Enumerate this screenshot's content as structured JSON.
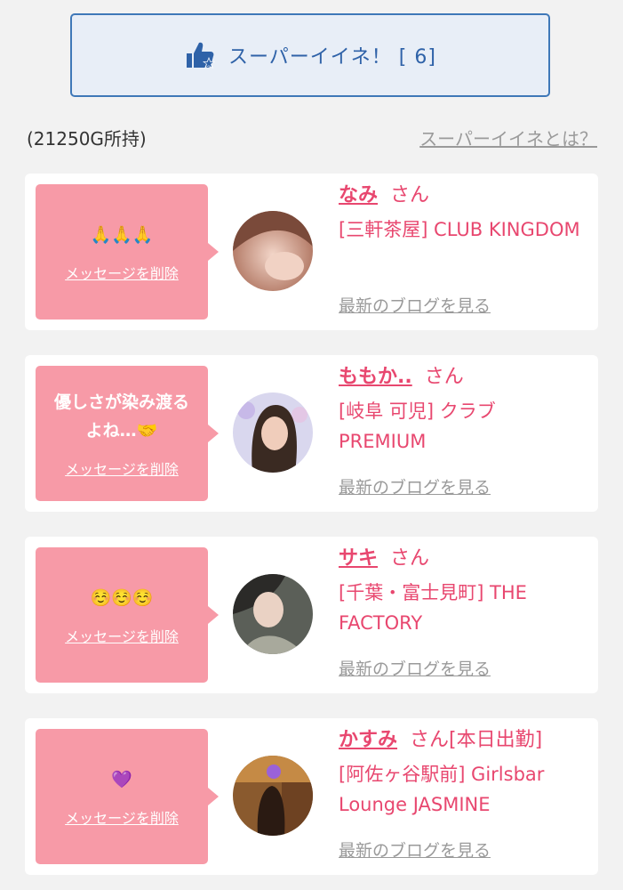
{
  "super_like": {
    "label": "スーパーイイネ！ [ 6]"
  },
  "header": {
    "balance": "(21250G所持)",
    "help_link": "スーパーイイネとは？"
  },
  "cards": [
    {
      "message": "🙏🙏🙏",
      "delete_label": "メッセージを削除",
      "name": "なみ",
      "san": "さん",
      "shop": "[三軒茶屋] CLUB KINGDOM",
      "blog": "最新のブログを見る"
    },
    {
      "message": "優しさが染み渡る\nよね…🤝",
      "delete_label": "メッセージを削除",
      "name": "ももか..",
      "san": "さん",
      "shop": "[岐阜 可児] クラブ PREMIUM",
      "blog": "最新のブログを見る"
    },
    {
      "message": "☺️☺️☺️",
      "delete_label": "メッセージを削除",
      "name": "サキ",
      "san": "さん",
      "shop": "[千葉・富士見町] THE FACTORY",
      "blog": "最新のブログを見る"
    },
    {
      "message": "💜",
      "delete_label": "メッセージを削除",
      "name": "かすみ",
      "san": "さん[本日出勤]",
      "shop": "[阿佐ヶ谷駅前] Girlsbar Lounge JASMINE",
      "blog": "最新のブログを見る"
    }
  ]
}
